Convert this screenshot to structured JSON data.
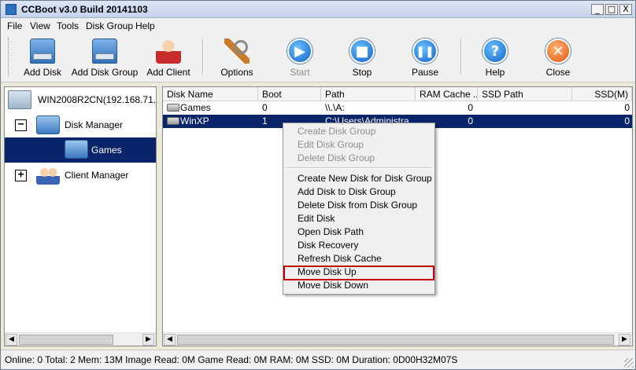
{
  "window": {
    "title": "CCBoot v3.0 Build 20141103",
    "minimize_glyph": "_",
    "maximize_glyph": "□",
    "close_glyph": "X"
  },
  "menubar": {
    "items": [
      "File",
      "View",
      "Tools",
      "Disk Group",
      "Help"
    ]
  },
  "toolbar": {
    "add_disk": "Add Disk",
    "add_disk_group": "Add Disk Group",
    "add_client": "Add Client",
    "options": "Options",
    "start": "Start",
    "stop": "Stop",
    "pause": "Pause",
    "help": "Help",
    "close": "Close",
    "start_disabled": true,
    "icons": {
      "add_disk": "disk-icon",
      "add_disk_group": "disk-group-icon",
      "add_client": "user-icon",
      "options": "wrench-icon",
      "start": "play-icon",
      "stop": "stop-icon",
      "pause": "pause-icon",
      "help": "help-icon",
      "close": "close-icon"
    },
    "icon_glyphs": {
      "start": "▶",
      "stop": "■",
      "pause": "❚❚",
      "help": "?",
      "close": "✕"
    }
  },
  "tree": {
    "root": "WIN2008R2CN(192.168.71.25",
    "disk_manager": "Disk Manager",
    "games": "Games",
    "client_manager": "Client Manager",
    "expander_collapse": "−",
    "expander_expand": "+"
  },
  "list": {
    "columns": [
      "Disk Name",
      "Boot",
      "Path",
      "RAM Cache ...",
      "SSD Path",
      "SSD(M)"
    ],
    "rows": [
      {
        "name": "Games",
        "boot": "0",
        "path": "\\\\.\\A:",
        "ram_cache": "0",
        "ssd_path": "",
        "ssd": "0",
        "selected": false
      },
      {
        "name": "WinXP",
        "boot": "1",
        "path": "C:\\Users\\Administra",
        "ram_cache": "0",
        "ssd_path": "",
        "ssd": "0",
        "selected": true
      }
    ]
  },
  "context_menu": {
    "disabled_items": [
      "Create Disk Group",
      "Edit Disk Group",
      "Delete Disk Group"
    ],
    "items": [
      "Create New Disk for Disk Group",
      "Add Disk to Disk Group",
      "Delete Disk from Disk Group",
      "Edit Disk",
      "Open Disk Path",
      "Disk Recovery",
      "Refresh Disk Cache",
      "Move Disk Up",
      "Move Disk Down"
    ],
    "highlighted": "Move Disk Up",
    "highlight_color": "#c00000"
  },
  "scroll": {
    "left": "◀",
    "right": "▶"
  },
  "status": {
    "text": "Online: 0 Total: 2 Mem: 13M Image Read: 0M Game Read: 0M RAM: 0M SSD: 0M Duration: 0D00H32M07S"
  },
  "colors": {
    "selection": "#0a246a",
    "accent": "#2e6fb7"
  }
}
